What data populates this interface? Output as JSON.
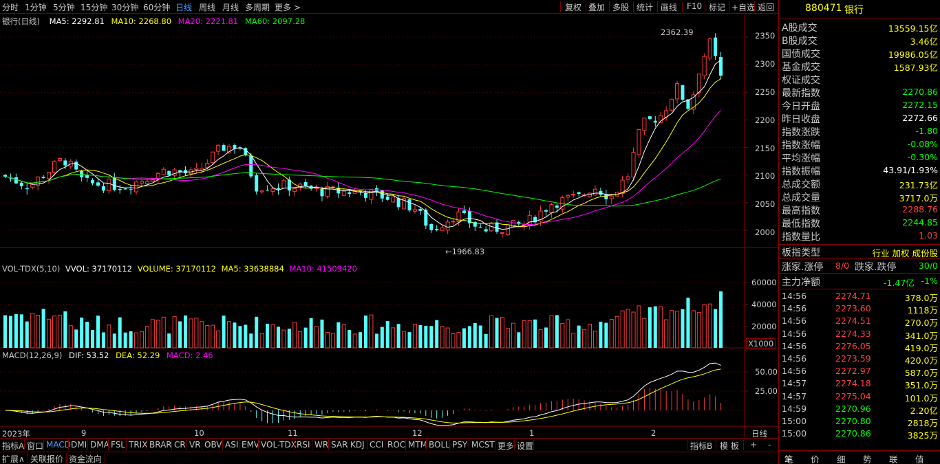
{
  "toolbar": {
    "periods": [
      "分时",
      "1分钟",
      "5分钟",
      "15分钟",
      "30分钟",
      "60分钟",
      "日线",
      "周线",
      "月线",
      "多周期",
      "更多 >"
    ],
    "active_period": "日线",
    "right_buttons": [
      "复权",
      "叠加",
      "多股",
      "统计",
      "画线",
      "F10",
      "标记",
      "+自选",
      "返回"
    ]
  },
  "main_pane": {
    "title": "银行(日线)",
    "ma_legend": [
      {
        "label": "MA5: 2292.81",
        "color": "#ffffff"
      },
      {
        "label": "MA10: 2268.80",
        "color": "#ffff00"
      },
      {
        "label": "MA20: 2221.81",
        "color": "#ff00ff"
      },
      {
        "label": "MA60: 2097.28",
        "color": "#00ff00"
      }
    ],
    "y_ticks": [
      "2350",
      "2300",
      "2250",
      "2200",
      "2150",
      "2100",
      "2050",
      "2000"
    ],
    "high_label": "2362.39",
    "low_label": "←1966.83"
  },
  "vol_pane": {
    "legend": [
      {
        "label": "VOL-TDX(5,10)",
        "color": "#c8c8c8"
      },
      {
        "label": "VVOL: 37170112",
        "color": "#ffffff"
      },
      {
        "label": "VOLUME: 37170112",
        "color": "#ffff00"
      },
      {
        "label": "MA5: 33638884",
        "color": "#ffff00"
      },
      {
        "label": "MA10: 41509420",
        "color": "#ff00ff"
      }
    ],
    "y_ticks": [
      "60000",
      "40000",
      "20000"
    ],
    "unit": "X1000"
  },
  "macd_pane": {
    "legend": [
      {
        "label": "MACD(12,26,9)",
        "color": "#c8c8c8"
      },
      {
        "label": "DIF: 53.52",
        "color": "#ffffff"
      },
      {
        "label": "DEA: 52.29",
        "color": "#ffff00"
      },
      {
        "label": "MACD: 2.46",
        "color": "#ff00ff"
      }
    ],
    "y_ticks": [
      "50.00",
      "25.00"
    ]
  },
  "date_axis": {
    "labels": [
      "2023年",
      "9",
      "10",
      "11",
      "12",
      "1",
      "2"
    ],
    "period": "日线"
  },
  "indicator_tabs": [
    "指标A",
    "窗口",
    "MACD",
    "DMI",
    "DMA",
    "FSL",
    "TRIX",
    "BRAR",
    "CR",
    "VR",
    "OBV",
    "ASI",
    "EMV",
    "VOL-TDX",
    "RSI",
    "WR",
    "SAR",
    "KDJ",
    "CCI",
    "ROC",
    "MTM",
    "BOLL",
    "PSY",
    "MCST",
    "更多",
    "设置"
  ],
  "indicator_right": [
    "指标B",
    "模 板",
    "+",
    "-"
  ],
  "bottom_tabs": [
    "扩展∧",
    "关联报价",
    "资金流向"
  ],
  "panel": {
    "code": "880471",
    "name": "银行",
    "rows": [
      {
        "label": "A股成交",
        "value": "13559.15亿",
        "color": "#ffff00"
      },
      {
        "label": "B股成交",
        "value": "3.46亿",
        "color": "#ffff00"
      },
      {
        "label": "国债成交",
        "value": "19986.05亿",
        "color": "#ffff00"
      },
      {
        "label": "基金成交",
        "value": "1587.93亿",
        "color": "#ffff00"
      },
      {
        "label": "权证成交",
        "value": "",
        "color": "#ffff00"
      },
      {
        "label": "最新指数",
        "value": "2270.86",
        "color": "#00ff00"
      },
      {
        "label": "今日开盘",
        "value": "2272.15",
        "color": "#00ff00"
      },
      {
        "label": "昨日收盘",
        "value": "2272.66",
        "color": "#ffffff"
      },
      {
        "label": "指数涨跌",
        "value": "-1.80",
        "color": "#00ff00"
      },
      {
        "label": "指数涨幅",
        "value": "-0.08%",
        "color": "#00ff00"
      },
      {
        "label": "平均涨幅",
        "value": "-0.30%",
        "color": "#00ff00"
      },
      {
        "label": "指数振幅",
        "value": "43.91/1.93%",
        "color": "#ffffff"
      },
      {
        "label": "总成交额",
        "value": "231.73亿",
        "color": "#ffff00"
      },
      {
        "label": "总成交量",
        "value": "3717.0万",
        "color": "#ffff00"
      },
      {
        "label": "最高指数",
        "value": "2288.76",
        "color": "#ff4040"
      },
      {
        "label": "最低指数",
        "value": "2244.85",
        "color": "#00ff00"
      },
      {
        "label": "指数量比",
        "value": "1.03",
        "color": "#ff4040"
      }
    ],
    "type_label": "板指类型",
    "type_value": "行业 加权 成份股",
    "updown_label": "涨家.涨停",
    "updown_value": "8/0",
    "downup_label": "跌家.跌停",
    "downup_value": "30/0",
    "flow_label": "主力净额",
    "flow_value": "-1.47亿",
    "flow_pct": "-1%",
    "ticks": [
      {
        "time": "14:56",
        "price": "2274.71",
        "vol": "378.0万",
        "pc": "#ff4040"
      },
      {
        "time": "14:56",
        "price": "2273.60",
        "vol": "1118万",
        "pc": "#ff4040"
      },
      {
        "time": "14:56",
        "price": "2274.51",
        "vol": "270.0万",
        "pc": "#ff4040"
      },
      {
        "time": "14:56",
        "price": "2274.33",
        "vol": "341.0万",
        "pc": "#ff4040"
      },
      {
        "time": "14:56",
        "price": "2276.05",
        "vol": "419.0万",
        "pc": "#ff4040"
      },
      {
        "time": "14:56",
        "price": "2273.59",
        "vol": "420.0万",
        "pc": "#ff4040"
      },
      {
        "time": "14:56",
        "price": "2272.97",
        "vol": "587.0万",
        "pc": "#ff4040"
      },
      {
        "time": "14:57",
        "price": "2274.18",
        "vol": "351.0万",
        "pc": "#ff4040"
      },
      {
        "time": "14:57",
        "price": "2275.04",
        "vol": "101.0万",
        "pc": "#ff4040"
      },
      {
        "time": "14:59",
        "price": "2270.96",
        "vol": "2.20亿",
        "pc": "#00ff00"
      },
      {
        "time": "15:00",
        "price": "2270.80",
        "vol": "2818万",
        "pc": "#00ff00"
      },
      {
        "time": "15:00",
        "price": "2270.86",
        "vol": "3825万",
        "pc": "#00ff00"
      }
    ],
    "bottom_tabs": [
      "笔",
      "价",
      "细",
      "势",
      "联",
      "值"
    ]
  }
}
